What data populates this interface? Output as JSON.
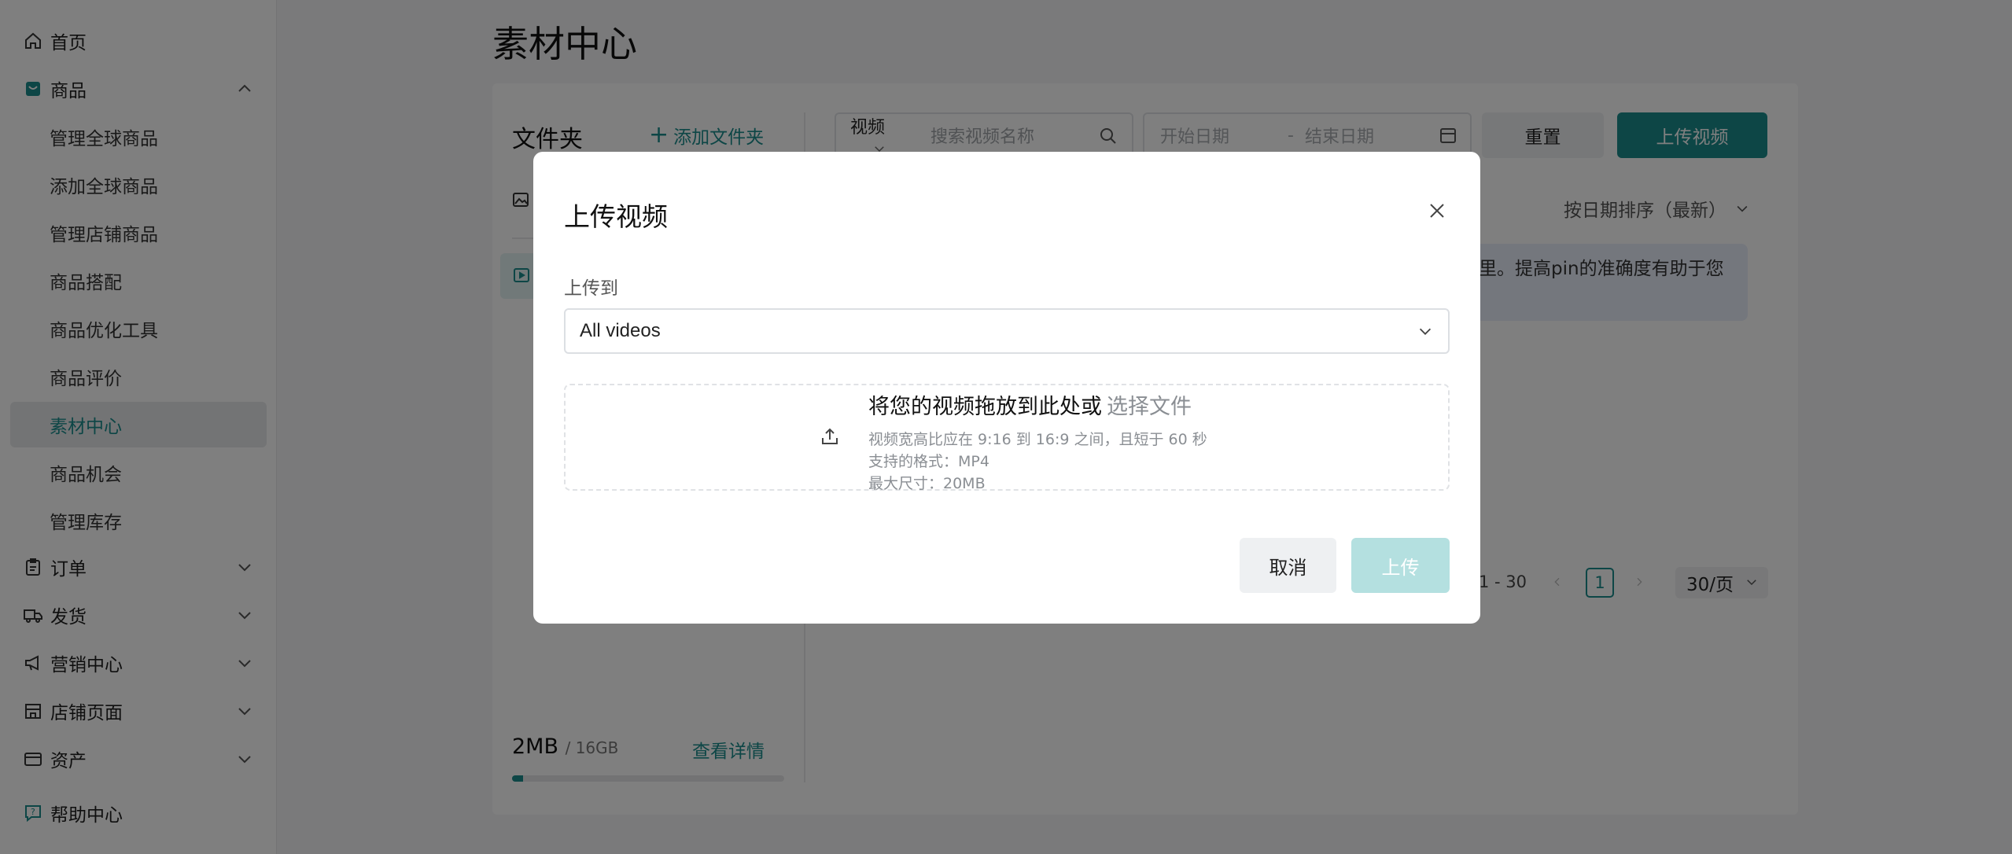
{
  "sidebar": {
    "home": "首页",
    "products": "商品",
    "product_subitems": [
      "管理全球商品",
      "添加全球商品",
      "管理店铺商品",
      "商品搭配",
      "商品优化工具",
      "商品评价",
      "素材中心",
      "商品机会",
      "管理库存"
    ],
    "active_subitem": "素材中心",
    "orders": "订单",
    "shipping": "发货",
    "marketing": "营销中心",
    "store_page": "店铺页面",
    "assets": "资产",
    "help": "帮助中心"
  },
  "page": {
    "title": "素材中心",
    "folders_title": "文件夹",
    "add_folder": "添加文件夹",
    "storage_used": "2MB",
    "storage_total": "/ 16GB",
    "storage_detail": "查看详情",
    "storage_fraction": 0.04
  },
  "filters": {
    "type_value": "视频",
    "search_placeholder": "搜索视频名称",
    "start_date": "开始日期",
    "date_sep": "-",
    "end_date": "结束日期",
    "reset": "重置",
    "upload_video": "上传视频"
  },
  "listing": {
    "sort": "按日期排序（最新）",
    "banner_line1": "里。提高pin的准确度有助于您",
    "range": "1 - 30",
    "current_page": "1",
    "per_page": "30/页"
  },
  "modal": {
    "title": "上传视频",
    "upload_to_label": "上传到",
    "destination": "All videos",
    "drop_text": "将您的视频拖放到此处或",
    "choose_file": "选择文件",
    "req_ratio": "视频宽高比应在 9:16 到 16:9 之间，且短于 60 秒",
    "req_format": "支持的格式：MP4",
    "req_size": "最大尺寸：20MB",
    "cancel": "取消",
    "upload": "上传"
  },
  "colors": {
    "accent": "#1a8c8c",
    "upload_disabled": "#b4e0e0"
  },
  "icons": {
    "home": "home-icon",
    "products": "product-icon",
    "orders": "clipboard-icon",
    "shipping": "truck-icon",
    "marketing": "megaphone-icon",
    "store_page": "store-icon",
    "assets": "wallet-icon",
    "help": "help-icon",
    "close": "close-icon",
    "upload": "upload-icon"
  }
}
